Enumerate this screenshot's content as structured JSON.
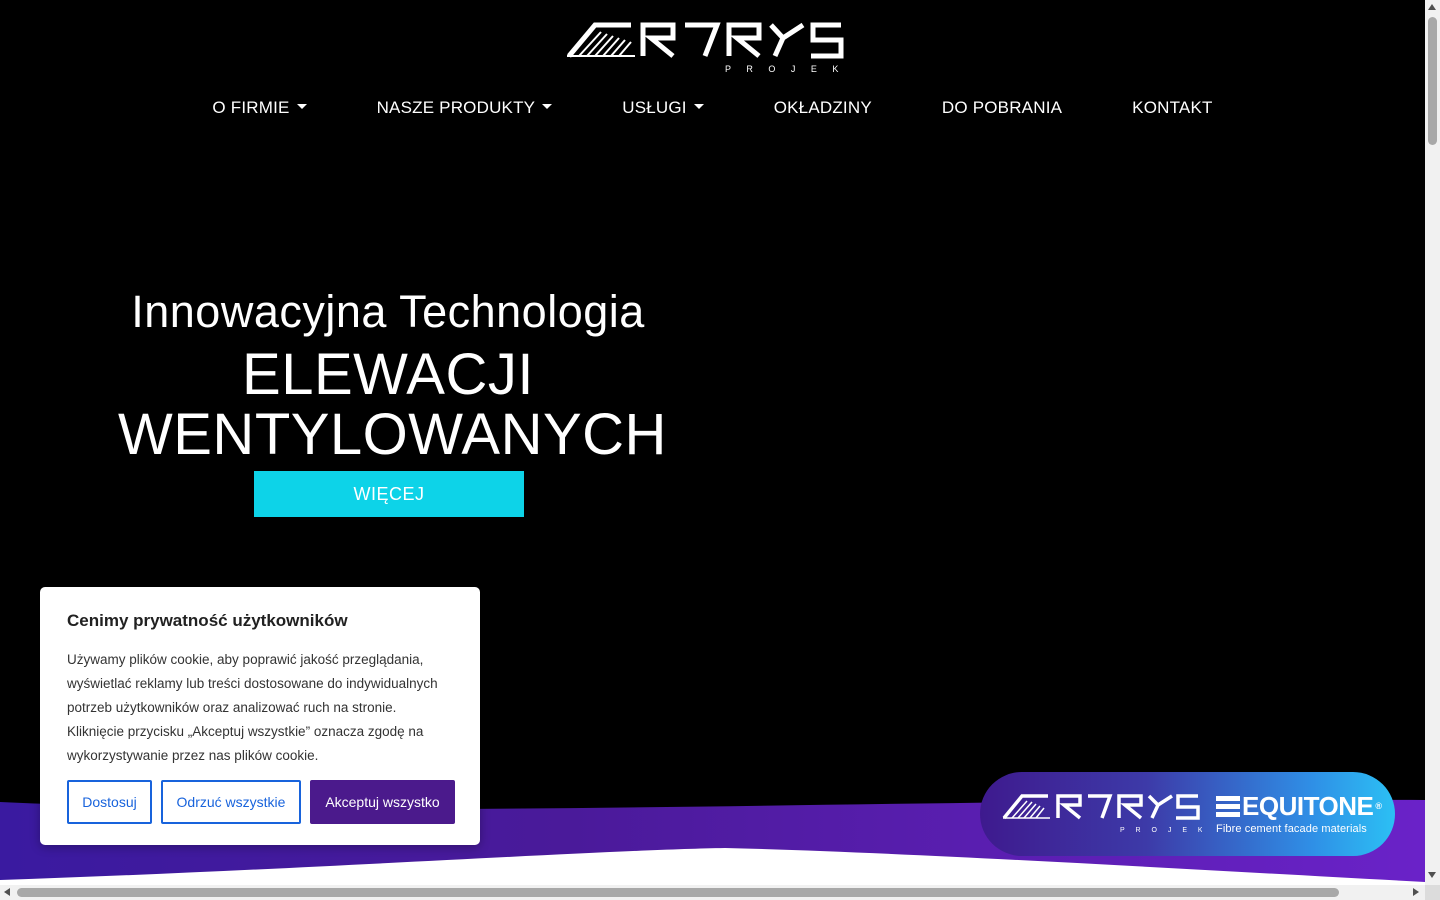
{
  "brand": {
    "logo_name": "ARTRYS",
    "logo_sub": "P R O J E K T"
  },
  "nav": {
    "items": [
      {
        "label": "O FIRMIE",
        "dropdown": true
      },
      {
        "label": "NASZE PRODUKTY",
        "dropdown": true
      },
      {
        "label": "USŁUGI",
        "dropdown": true
      },
      {
        "label": "OKŁADZINY",
        "dropdown": false
      },
      {
        "label": "DO POBRANIA",
        "dropdown": false
      },
      {
        "label": "KONTAKT",
        "dropdown": false
      }
    ]
  },
  "hero": {
    "line1": "Innowacyjna Technologia",
    "line2": "ELEWACJI",
    "line3": "WENTYLOWANYCH",
    "button_label": "WIĘCEJ",
    "button_color": "#0dd3e8"
  },
  "partner_badge": {
    "partner_name": "EQUITONE",
    "partner_tagline": "Fibre cement facade materials",
    "reg_mark": "®"
  },
  "cookie": {
    "title": "Cenimy prywatność użytkowników",
    "text": "Używamy plików cookie, aby poprawić jakość przeglądania, wyświetlać reklamy lub treści dostosowane do indywidualnych potrzeb użytkowników oraz analizować ruch na stronie. Kliknięcie przycisku „Akceptuj wszystkie” oznacza zgodę na wykorzystywanie przez nas plików cookie.",
    "btn_customize": "Dostosuj",
    "btn_reject": "Odrzuć wszystkie",
    "btn_accept": "Akceptuj wszystko",
    "accent_color": "#1863dc",
    "primary_color": "#4b1a8c"
  }
}
